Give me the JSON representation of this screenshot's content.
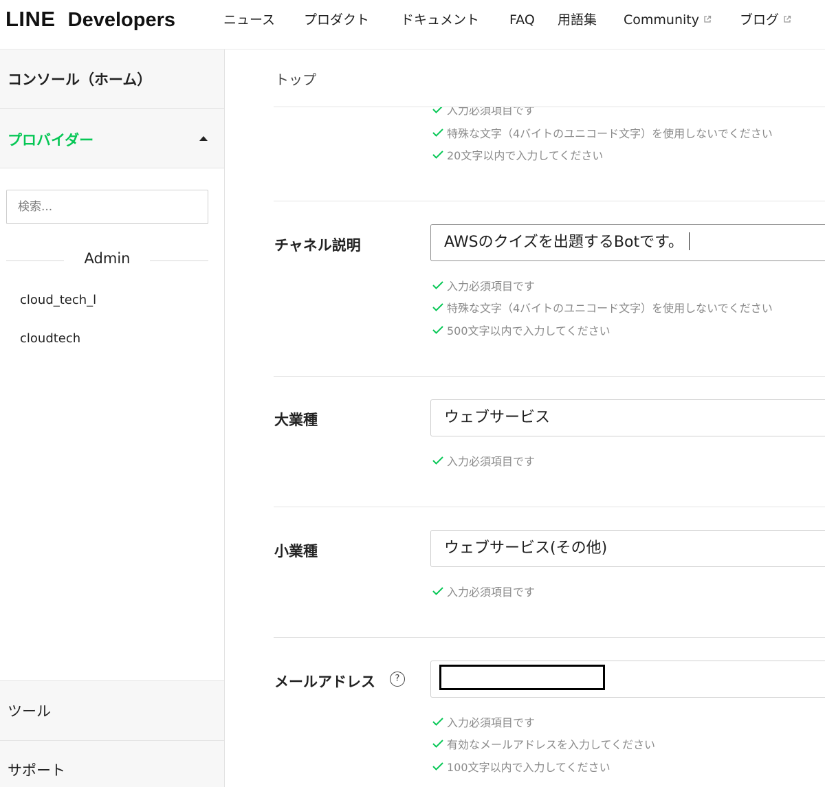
{
  "header": {
    "logo_line": "LINE",
    "logo_dev": "Developers",
    "nav": [
      {
        "label": "ニュース",
        "external": false
      },
      {
        "label": "プロダクト",
        "external": false
      },
      {
        "label": "ドキュメント",
        "external": false
      },
      {
        "label": "FAQ",
        "external": false
      },
      {
        "label": "用語集",
        "external": false
      },
      {
        "label": "Community",
        "external": true
      },
      {
        "label": "ブログ",
        "external": true
      }
    ]
  },
  "sidebar": {
    "home": "コンソール（ホーム）",
    "providers_label": "プロバイダー",
    "search_placeholder": "検索...",
    "group": "Admin",
    "providers": [
      "cloud_tech_l",
      "cloudtech"
    ],
    "tools": "ツール",
    "support": "サポート"
  },
  "main": {
    "breadcrumb": "トップ",
    "clipped_rule": "入力必須項目です",
    "top_rules": [
      "特殊な文字（4バイトのユニコード文字）を使用しないでください",
      "20文字以内で入力してください"
    ],
    "fields": {
      "description": {
        "label": "チャネル説明",
        "value": "AWSのクイズを出題するBotです。",
        "rules": [
          "入力必須項目です",
          "特殊な文字（4バイトのユニコード文字）を使用しないでください",
          "500文字以内で入力してください"
        ]
      },
      "major_industry": {
        "label": "大業種",
        "value": "ウェブサービス",
        "rules": [
          "入力必須項目です"
        ]
      },
      "minor_industry": {
        "label": "小業種",
        "value": "ウェブサービス(その他)",
        "rules": [
          "入力必須項目です"
        ]
      },
      "email": {
        "label": "メールアドレス",
        "help": "?",
        "value": "",
        "rules": [
          "入力必須項目です",
          "有効なメールアドレスを入力してください",
          "100文字以内で入力してください"
        ]
      }
    }
  },
  "colors": {
    "brand_green": "#06c755",
    "rule_check": "#06c755",
    "rule_text": "#8a8a8a"
  }
}
